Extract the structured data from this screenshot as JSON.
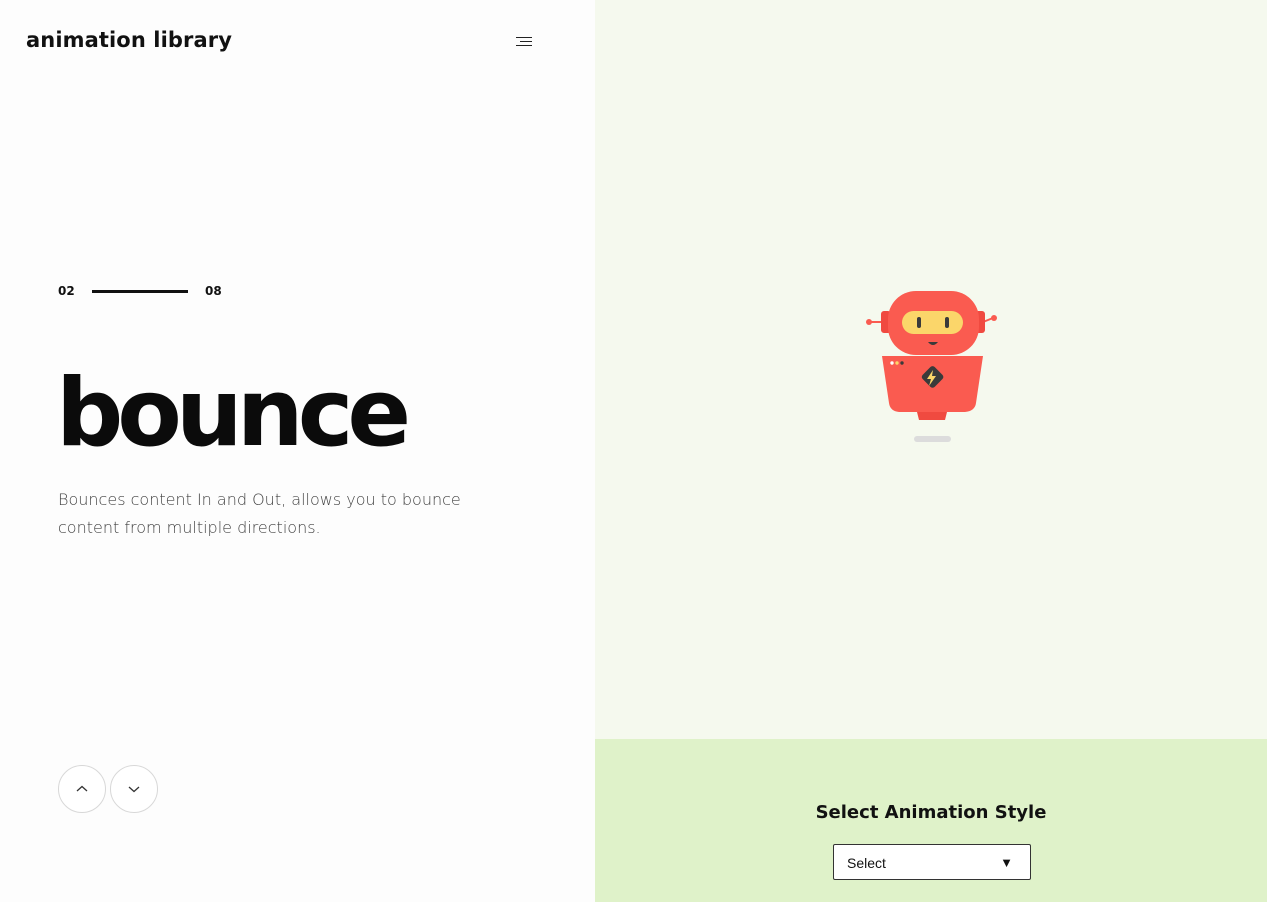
{
  "header": {
    "brand": "animation library",
    "menu_icon": "hamburger-menu-icon"
  },
  "slide": {
    "current": "02",
    "total": "08",
    "progress": 0.25,
    "title": "bounce",
    "description": "Bounces content In and Out, allows you to bounce content from multiple directions."
  },
  "nav": {
    "prev_icon": "chevron-up-icon",
    "next_icon": "chevron-down-icon"
  },
  "preview": {
    "illustration": "robot-illustration",
    "background": "#f5f9ee"
  },
  "controls": {
    "label": "Select Animation Style",
    "select_value": "Select",
    "select_arrow": "▼",
    "background": "#dff2c9"
  },
  "colors": {
    "robot_body": "#fa5b50",
    "robot_visor": "#fbd66a",
    "text_dark": "#111111"
  }
}
